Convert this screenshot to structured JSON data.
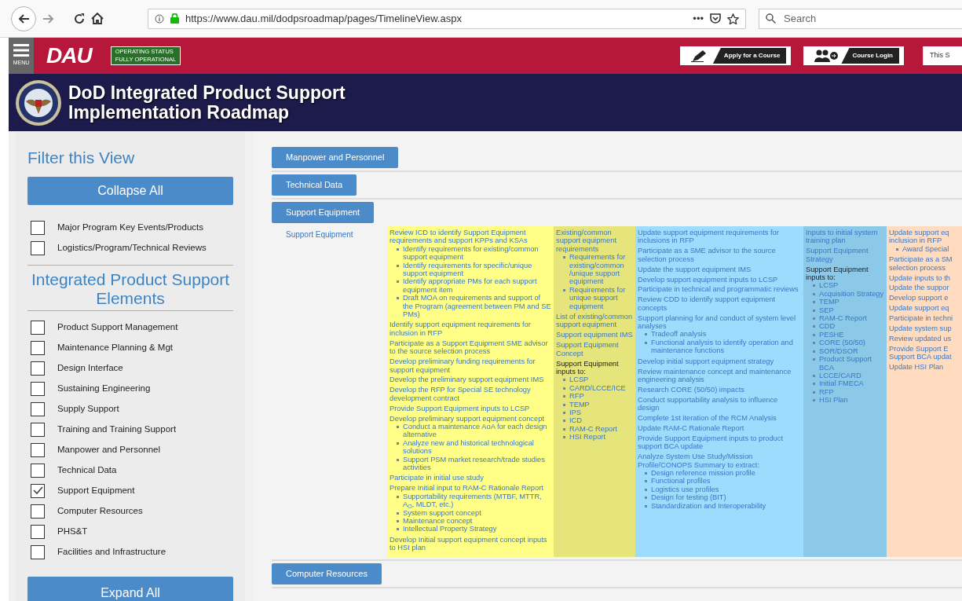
{
  "browser": {
    "url": "https://www.dau.mil/dodpsroadmap/pages/TimelineView.aspx",
    "more": "•••",
    "search": {
      "placeholder": "Search"
    }
  },
  "header": {
    "menu_label": "MENU",
    "logo": "DAU",
    "status": "OPERATING STATUS\nFULLY OPERATIONAL",
    "buttons": [
      {
        "label": "Apply for a Course",
        "kind": "apply"
      },
      {
        "label": "Course Login",
        "kind": "login"
      }
    ],
    "search": {
      "placeholder": "This S"
    }
  },
  "banner": {
    "title": "DoD Integrated Product Support\nImplementation Roadmap"
  },
  "sidebar": {
    "title": "Filter this View",
    "collapse_button": "Collapse All",
    "filters": [
      {
        "label": "Major Program Key Events/Products",
        "checked": false
      },
      {
        "label": "Logistics/Program/Technical Reviews",
        "checked": false
      }
    ],
    "elements_heading": "Integrated Product Support Elements",
    "elements": [
      {
        "label": "Product Support Management",
        "checked": false
      },
      {
        "label": "Maintenance Planning & Mgt",
        "checked": false
      },
      {
        "label": "Design Interface",
        "checked": false
      },
      {
        "label": "Sustaining Engineering",
        "checked": false
      },
      {
        "label": "Supply Support",
        "checked": false
      },
      {
        "label": "Training and Training Support",
        "checked": false
      },
      {
        "label": "Manpower and Personnel",
        "checked": false
      },
      {
        "label": "Technical Data",
        "checked": false
      },
      {
        "label": "Support Equipment",
        "checked": true
      },
      {
        "label": "Computer Resources",
        "checked": false
      },
      {
        "label": "PHS&T",
        "checked": false
      },
      {
        "label": "Facilities and Infrastructure",
        "checked": false
      }
    ],
    "expand_button": "Expand All"
  },
  "sections": [
    {
      "label": "Manpower and Personnel"
    },
    {
      "label": "Technical Data"
    },
    {
      "label": "Support Equipment",
      "row_label": "Support Equipment",
      "columns": [
        {
          "color": "#ffff88",
          "items": [
            {
              "kind": "link",
              "text": "Review ICD to identify Support Equipment requirements and support KPPs and KSAs",
              "children": [
                "Identify requirements for existing/common support equipment",
                "Identify requirements for specific/unique support equipment",
                "Identify appropriate PMs for each support equipment item",
                "Draft MOA on requirements and support of the Program (agreement between PM and SE PMs)"
              ]
            },
            {
              "kind": "link",
              "text": "Identify support equipment requirements for inclusion in RFP"
            },
            {
              "kind": "link",
              "text": "Participate as a Support Equipment SME advisor to the source selection process"
            },
            {
              "kind": "link",
              "text": "Develop preliminary funding requirements for support equipment"
            },
            {
              "kind": "link",
              "text": "Develop the preliminary support equipment IMS"
            },
            {
              "kind": "link",
              "text": "Develop the RFP for Special SE technology development contract"
            },
            {
              "kind": "link",
              "text": "Provide Support Equipment inputs to LCSP"
            },
            {
              "kind": "link",
              "text": "Develop preliminary support equipment concept",
              "children": [
                "Conduct a maintenance AoA for each design alternative",
                "Analyze new and historical technological solutions",
                "Support PSM market research/trade studies activities"
              ]
            },
            {
              "kind": "link",
              "text": "Participate in initial use study"
            },
            {
              "kind": "link",
              "text": "Prepare Initial input to RAM-C Rationale Report",
              "children": [
                "Supportability requirements (MTBF, MTTR, A$_{O}$, MLDT, etc.)",
                "System support concept",
                "Maintenance concept",
                "Intellectual Property Strategy"
              ]
            },
            {
              "kind": "link",
              "text": "Develop Initial support equipment concept inputs to HSI plan"
            }
          ]
        },
        {
          "color": "#e5e57c",
          "items": [
            {
              "kind": "link",
              "text": "Existing/common support equipment requirements",
              "children": [
                "Requirements for existing/common /unique support equipment",
                "Requirements for unique support equipment"
              ]
            },
            {
              "kind": "link",
              "text": "List of existing/common support equipment"
            },
            {
              "kind": "link",
              "text": "Support equipment IMS"
            },
            {
              "kind": "link",
              "text": "Support Equipment Concept"
            },
            {
              "kind": "heading",
              "text": "Support Equipment inputs to:",
              "children": [
                "LCSP",
                "CARD/LCCE/ICE",
                "RFP",
                "TEMP",
                "IPS",
                "ICD",
                "RAM-C Report",
                "HSI Report"
              ]
            }
          ]
        },
        {
          "color": "#9edcfd",
          "items": [
            {
              "kind": "link",
              "text": "Update support equipment requirements for inclusions in RFP"
            },
            {
              "kind": "link",
              "text": "Participate as a SME advisor to the source selection process"
            },
            {
              "kind": "link",
              "text": "Update the support equipment IMS"
            },
            {
              "kind": "link",
              "text": "Develop support equipment inputs to LCSP"
            },
            {
              "kind": "link",
              "text": "Participate in technical and programmatic reviews"
            },
            {
              "kind": "link",
              "text": "Review CDD to identify support equipment concepts"
            },
            {
              "kind": "link",
              "text": "Support planning for and conduct of system level analyses",
              "children": [
                "Tradeoff analysis",
                "Functional analysis to identify operation and maintenance functions"
              ]
            },
            {
              "kind": "link",
              "text": "Develop initial support equipment strategy"
            },
            {
              "kind": "link",
              "text": "Review maintenance concept and maintenance engineering analysis"
            },
            {
              "kind": "link",
              "text": "Research CORE (50/50) impacts"
            },
            {
              "kind": "link",
              "text": "Conduct supportability analysis to influence design"
            },
            {
              "kind": "link",
              "text": "Complete 1st iteration of the RCM Analysis"
            },
            {
              "kind": "link",
              "text": "Update RAM-C Rationale Report"
            },
            {
              "kind": "link",
              "text": "Provide Support Equipment inputs to product support BCA update"
            },
            {
              "kind": "link",
              "text": "Analyze System Use Study/Mission Profile/CONOPS Summary to extract:",
              "children": [
                "Design reference mission profile",
                "Functional profiles",
                "Logistics use profiles",
                "Design for testing (BIT)",
                "Standardization and Interoperability"
              ]
            }
          ]
        },
        {
          "color": "#8cc8e8",
          "items": [
            {
              "kind": "link",
              "text": "Inputs to initial system training plan"
            },
            {
              "kind": "link",
              "text": "Support Equipment Strategy"
            },
            {
              "kind": "heading",
              "text": "Support Equipment inputs to:",
              "children": [
                "LCSP",
                "Acquisition Strategy",
                "TEMP",
                "SEP",
                "RAM-C Report",
                "CDD",
                "PESHE",
                "CORE (50/50)",
                "SOR/DSOR",
                "Product Support BCA",
                "LCCE/CARD",
                "Initial FMECA",
                "RFP",
                "HSI Plan"
              ]
            }
          ]
        },
        {
          "color": "#ffdcc0",
          "items": [
            {
              "kind": "link",
              "text": "Update support eq\ninclusion in RFP",
              "children": [
                "Award Special"
              ]
            },
            {
              "kind": "link",
              "text": "Participate as a SM\nselection process"
            },
            {
              "kind": "link",
              "text": "Update inputs to th"
            },
            {
              "kind": "link",
              "text": "Update the suppor"
            },
            {
              "kind": "link",
              "text": "Develop support e"
            },
            {
              "kind": "link",
              "text": "Update support eq"
            },
            {
              "kind": "link",
              "text": "Participate in techni"
            },
            {
              "kind": "link",
              "text": "Update system sup"
            },
            {
              "kind": "link",
              "text": "Review updated us"
            },
            {
              "kind": "link",
              "text": "Provide Support E\nSupport BCA updat"
            },
            {
              "kind": "link",
              "text": "Update HSI Plan"
            }
          ]
        }
      ]
    },
    {
      "label": "Computer Resources"
    }
  ]
}
